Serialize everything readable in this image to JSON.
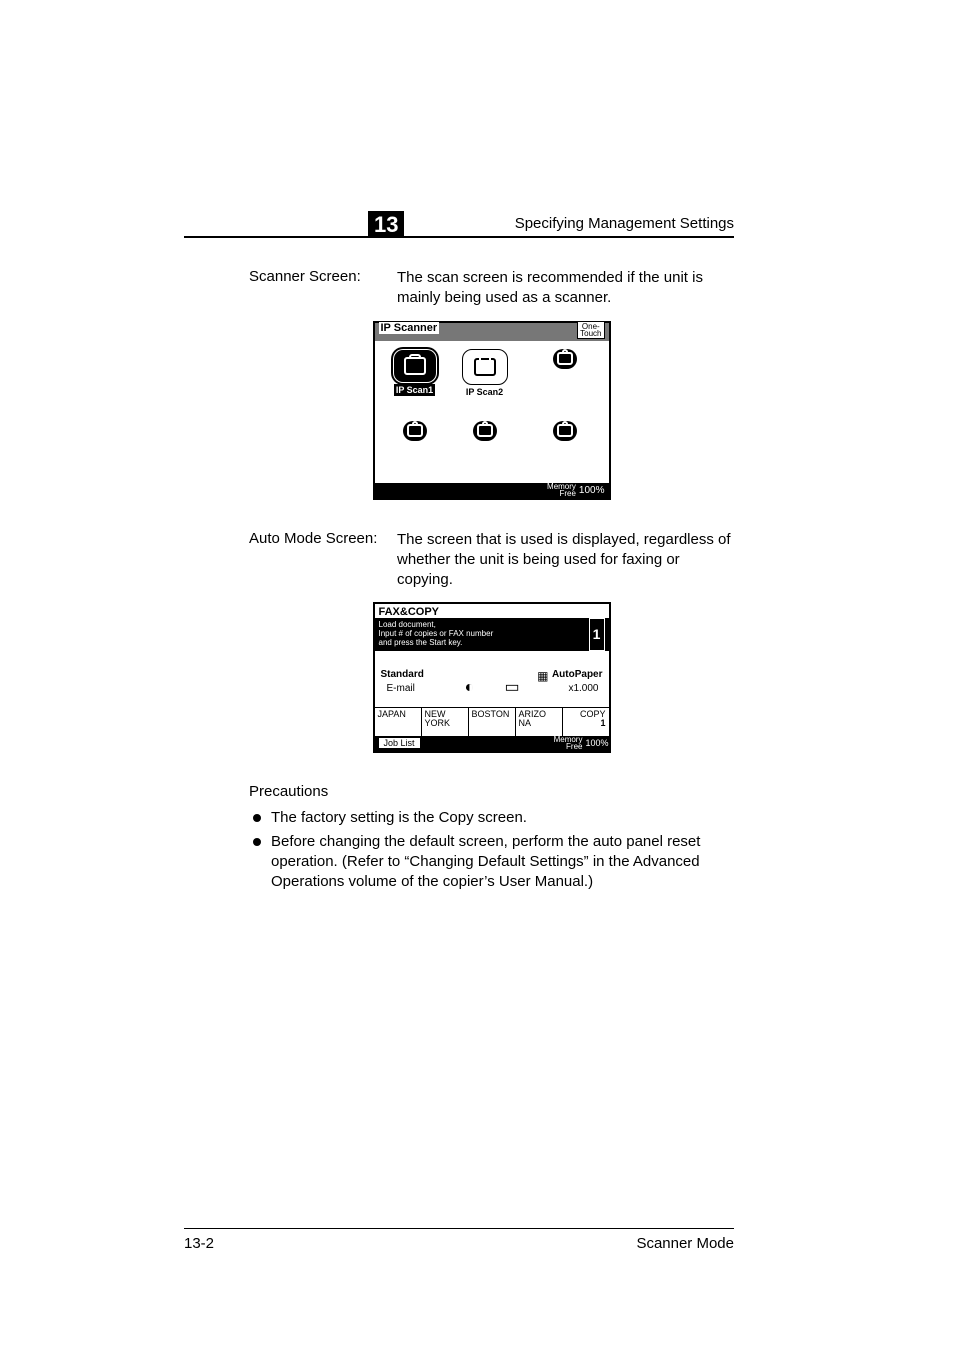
{
  "header": {
    "chapter": "13",
    "title": "Specifying Management Settings"
  },
  "screens": {
    "scanner": {
      "label": "Scanner Screen:",
      "desc": "The scan screen is recommended if the unit is mainly being used as a scanner.",
      "titlebar": "IP Scanner",
      "onetouch_l1": "One-",
      "onetouch_l2": "Touch",
      "btn1": "IP Scan1",
      "btn2": "IP Scan2",
      "mem_l1": "Memory",
      "mem_l2": "Free",
      "mem_val": "100%"
    },
    "auto": {
      "label": "Auto Mode Screen:",
      "desc": "The screen that is used is displayed, regardless of whether the unit is being used for faxing or copying.",
      "title": "FAX&COPY",
      "banner_l1": "Load document,",
      "banner_l2": "Input # of copies or FAX number",
      "banner_l3": "and press the Start key.",
      "banner_num": "1",
      "standard": "Standard",
      "email": "E-mail",
      "autopaper": "AutoPaper",
      "zoom": "x1.000",
      "tabs": {
        "t1": "JAPAN",
        "t2": "NEW YORK",
        "t3": "BOSTON",
        "t4": "ARIZO NA",
        "t5": "COPY",
        "t5n": "1"
      },
      "joblist": "Job List",
      "mem_l1": "Memory",
      "mem_l2": "Free",
      "mem_val": "100%"
    }
  },
  "precautions": {
    "heading": "Precautions",
    "b1": "The factory setting is the Copy screen.",
    "b2": "Before changing the default screen, perform the auto panel reset operation. (Refer to “Changing Default Settings” in the Advanced Operations volume of the copier’s User Manual.)"
  },
  "footer": {
    "page": "13-2",
    "mode": "Scanner Mode"
  }
}
